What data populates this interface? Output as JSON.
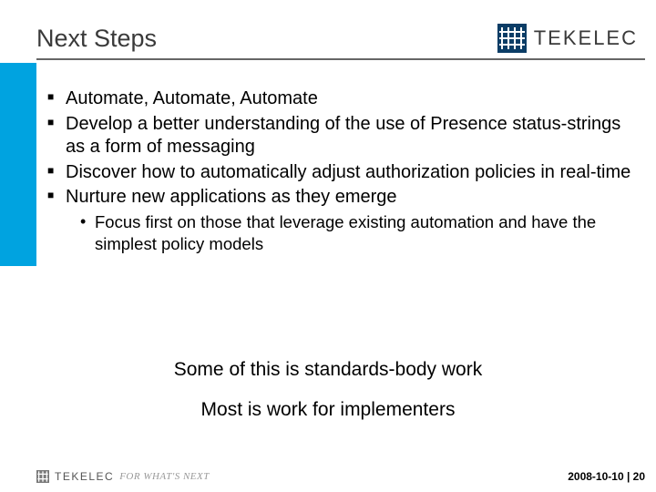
{
  "header": {
    "title": "Next Steps",
    "brand_name": "TEKELEC"
  },
  "bullets": [
    {
      "text": "Automate, Automate, Automate"
    },
    {
      "text": "Develop a better understanding of the use of Presence status-strings as a form of messaging"
    },
    {
      "text": "Discover how to automatically adjust authorization policies in real-time"
    },
    {
      "text": "Nurture new applications as they emerge",
      "sub": [
        "Focus first on those that leverage existing automation and have the simplest policy models"
      ]
    }
  ],
  "closing": {
    "line1": "Some of this is standards-body work",
    "line2": "Most is work for implementers"
  },
  "footer": {
    "brand": "TEKELEC",
    "tagline": "FOR WHAT'S NEXT",
    "date_page": "2008-10-10 | 20"
  }
}
